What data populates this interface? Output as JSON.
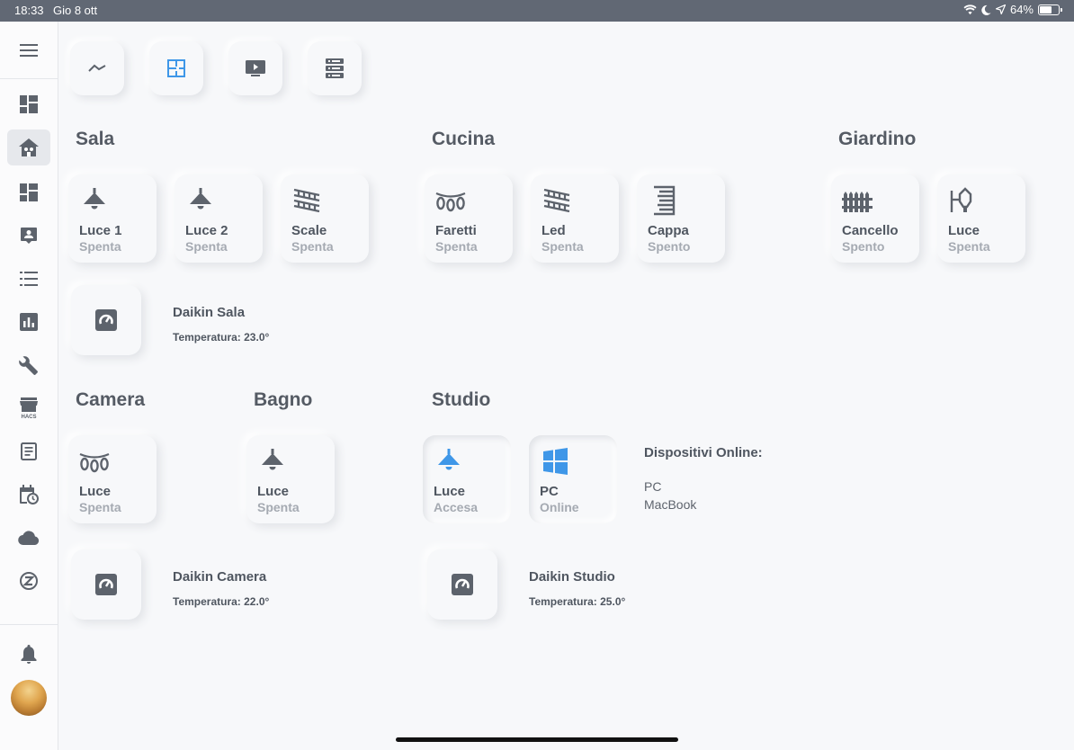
{
  "statusbar": {
    "time": "18:33",
    "date": "Gio 8 ott",
    "battery": "64%",
    "battery_level": 0.64
  },
  "sidebar": {
    "items": [
      {
        "icon": "dashboard-icon"
      },
      {
        "icon": "home-floorplan-icon",
        "active": true
      },
      {
        "icon": "dashboard-icon"
      },
      {
        "icon": "account-box-icon"
      },
      {
        "icon": "format-list-icon"
      },
      {
        "icon": "chart-bar-icon"
      },
      {
        "icon": "wrench-icon"
      },
      {
        "icon": "hacs-store-icon",
        "label": "HACS"
      },
      {
        "icon": "logbook-icon"
      },
      {
        "icon": "calendar-clock-icon"
      },
      {
        "icon": "cloud-icon"
      },
      {
        "icon": "z-wave-icon"
      }
    ],
    "bottom": [
      {
        "icon": "bell-icon"
      },
      {
        "icon": "avatar"
      }
    ]
  },
  "top_buttons": [
    {
      "icon": "chevron-up-icon"
    },
    {
      "icon": "floor-plan-icon",
      "active": true,
      "color": "#3f97e8"
    },
    {
      "icon": "tv-play-icon"
    },
    {
      "icon": "server-icon"
    }
  ],
  "sections": {
    "sala": {
      "title": "Sala",
      "tiles": [
        {
          "name": "Luce 1",
          "state": "Spenta",
          "icon": "ceiling-light-icon"
        },
        {
          "name": "Luce 2",
          "state": "Spenta",
          "icon": "ceiling-light-icon"
        },
        {
          "name": "Scale",
          "state": "Spenta",
          "icon": "led-strip-icon"
        }
      ],
      "climate": {
        "name": "Daikin Sala",
        "temp": "Temperatura: 23.0°",
        "icon": "air-conditioner-icon"
      }
    },
    "cucina": {
      "title": "Cucina",
      "tiles": [
        {
          "name": "Faretti",
          "state": "Spenta",
          "icon": "string-lights-icon"
        },
        {
          "name": "Led",
          "state": "Spenta",
          "icon": "led-strip-icon"
        },
        {
          "name": "Cappa",
          "state": "Spento",
          "icon": "range-hood-icon"
        }
      ]
    },
    "giardino": {
      "title": "Giardino",
      "tiles": [
        {
          "name": "Cancello",
          "state": "Spento",
          "icon": "gate-icon"
        },
        {
          "name": "Luce",
          "state": "Spenta",
          "icon": "outdoor-lamp-icon"
        }
      ]
    },
    "camera": {
      "title": "Camera",
      "tiles": [
        {
          "name": "Luce",
          "state": "Spenta",
          "icon": "string-lights-icon"
        }
      ],
      "climate": {
        "name": "Daikin Camera",
        "temp": "Temperatura: 22.0°",
        "icon": "air-conditioner-icon"
      }
    },
    "bagno": {
      "title": "Bagno",
      "tiles": [
        {
          "name": "Luce",
          "state": "Spenta",
          "icon": "ceiling-light-icon"
        }
      ]
    },
    "studio": {
      "title": "Studio",
      "tiles": [
        {
          "name": "Luce",
          "state": "Accesa",
          "icon": "ceiling-light-icon",
          "on": true
        },
        {
          "name": "PC",
          "state": "Online",
          "icon": "windows-icon",
          "on": true
        }
      ],
      "online": {
        "title": "Dispositivi Online:",
        "devices": [
          "PC",
          "MacBook"
        ]
      },
      "climate": {
        "name": "Daikin Studio",
        "temp": "Temperatura: 25.0°",
        "icon": "air-conditioner-icon"
      }
    }
  },
  "colors": {
    "accent": "#3f97e8",
    "icon": "#5d636c",
    "muted": "#a5aab2"
  }
}
